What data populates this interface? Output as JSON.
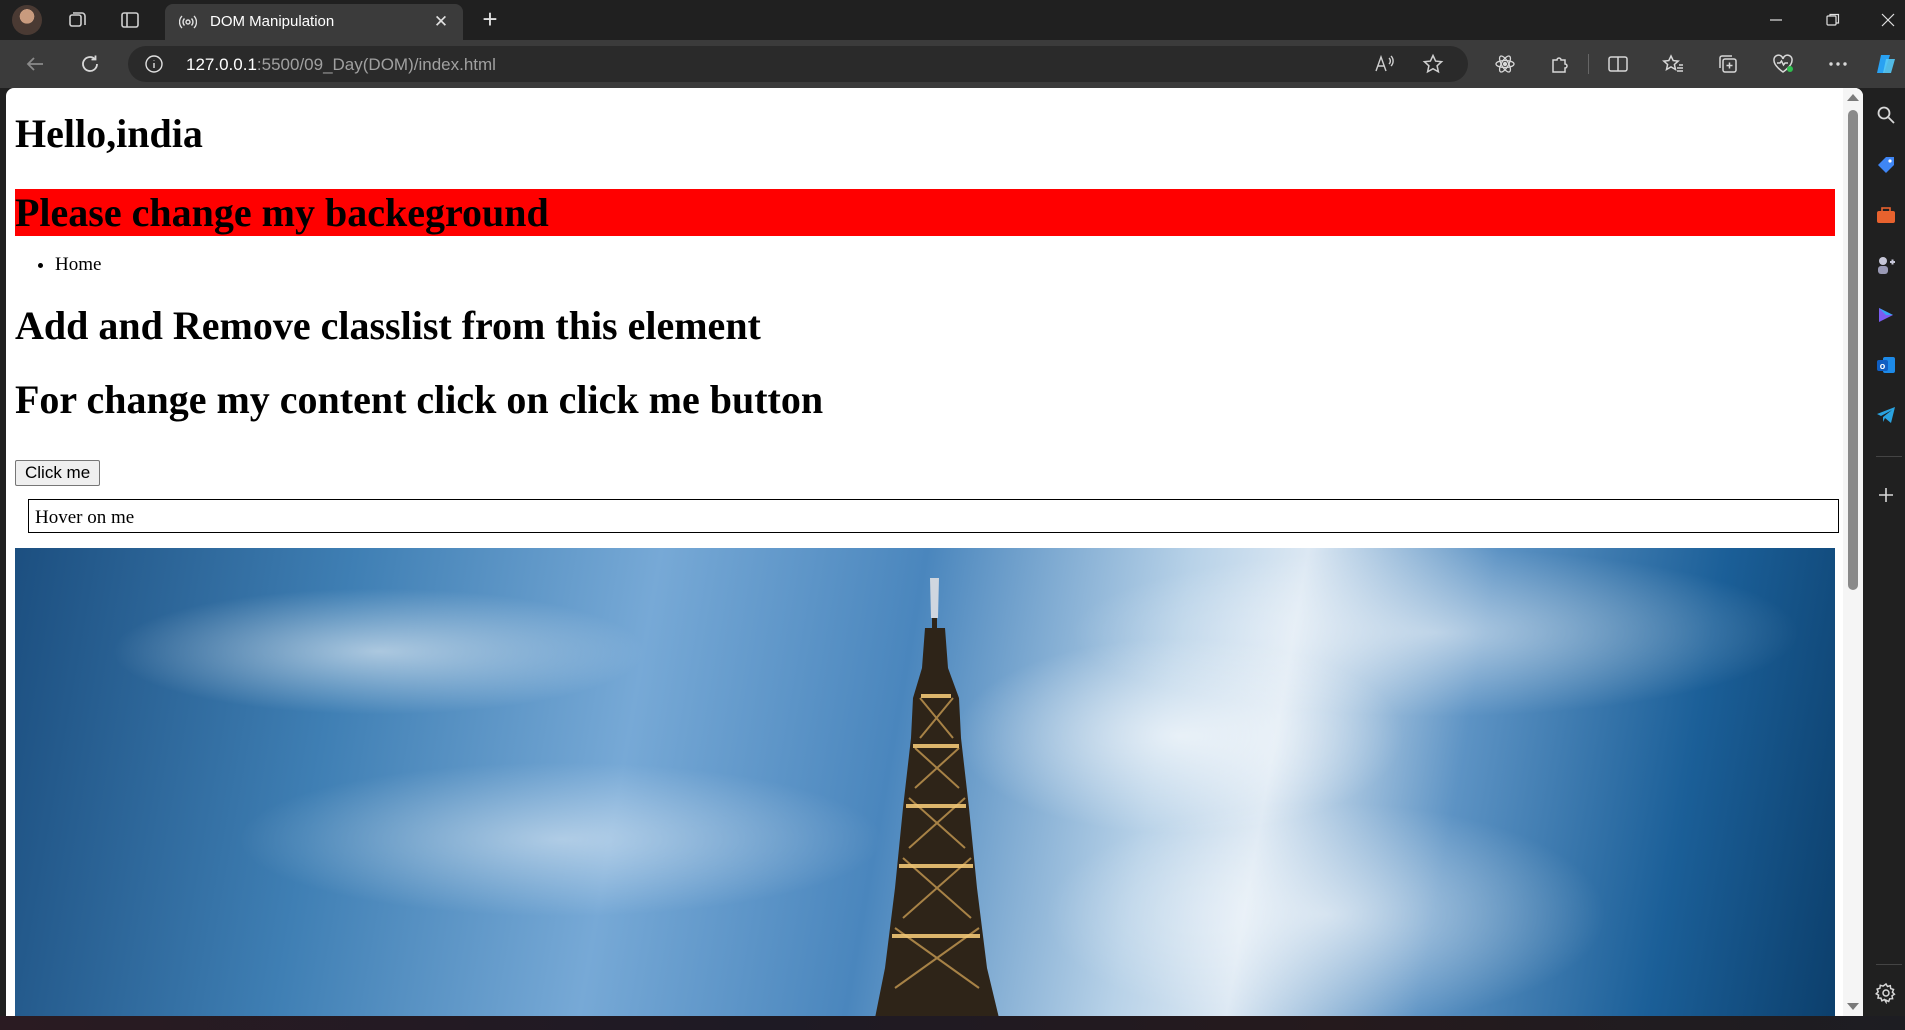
{
  "browser": {
    "tab": {
      "title": "DOM Manipulation"
    },
    "address": {
      "host": "127.0.0.1",
      "path": ":5500/09_Day(DOM)/index.html"
    }
  },
  "page": {
    "heading_hello": "Hello,india",
    "heading_background": "Please change my backeground",
    "nav_items": [
      "Home"
    ],
    "heading_classlist": "Add and Remove classlist from this element",
    "heading_content": "For change my content click on click me button",
    "button_label": "Click me",
    "hover_box": "Hover on me",
    "highlight_color": "#ff0000"
  },
  "icons": {
    "tabstrip": [
      "profile-avatar",
      "workspaces-icon",
      "tab-actions-icon",
      "new-tab-icon"
    ],
    "window": [
      "minimize-icon",
      "restore-icon",
      "close-icon"
    ],
    "toolbar": [
      "back-icon",
      "refresh-icon",
      "site-info-icon",
      "read-aloud-icon",
      "favorite-star-icon",
      "react-devtools-icon",
      "extensions-icon",
      "split-screen-icon",
      "favorites-icon",
      "collections-icon",
      "browser-essentials-icon",
      "more-icon"
    ],
    "sidebar": [
      "search-icon",
      "shopping-tag-icon",
      "tools-briefcase-icon",
      "games-icon",
      "copilot-icon",
      "outlook-icon",
      "telegram-icon",
      "add-icon",
      "settings-gear-icon"
    ]
  }
}
